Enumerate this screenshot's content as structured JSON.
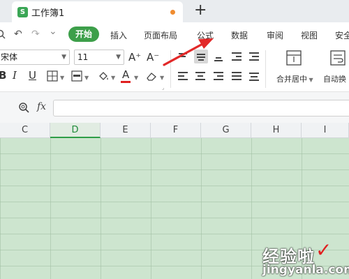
{
  "tab": {
    "icon_letter": "S",
    "title": "工作簿1",
    "new_tab_glyph": "+",
    "brand_color": "#3aa655",
    "unsaved_dot_color": "#f08c30"
  },
  "menu": {
    "active": "开始",
    "items": [
      "插入",
      "页面布局",
      "公式",
      "数据",
      "审阅",
      "视图",
      "安全"
    ],
    "active_color": "#3d9f4a"
  },
  "quick_access": {
    "undo_glyph": "↶",
    "redo_glyph": "↷",
    "dropdown_glyph": "⌄"
  },
  "ribbon": {
    "font_name": "宋体",
    "font_size": "11",
    "increase_font": "A⁺",
    "decrease_font": "A⁻",
    "bold": "B",
    "italic": "I",
    "underline": "U",
    "font_color_letter": "A",
    "font_color_value": "#e02020",
    "merge_center": "合并居中",
    "wrap_text": "自动换"
  },
  "formula_bar": {
    "fx": "fx",
    "value": ""
  },
  "columns": [
    "C",
    "D",
    "E",
    "F",
    "G",
    "H",
    "I"
  ],
  "active_column": "D",
  "sheet": {
    "fill_color": "#cde5cf"
  },
  "watermark": {
    "cn": "经验啦",
    "check": "✓",
    "en": "jingyanla.com"
  }
}
